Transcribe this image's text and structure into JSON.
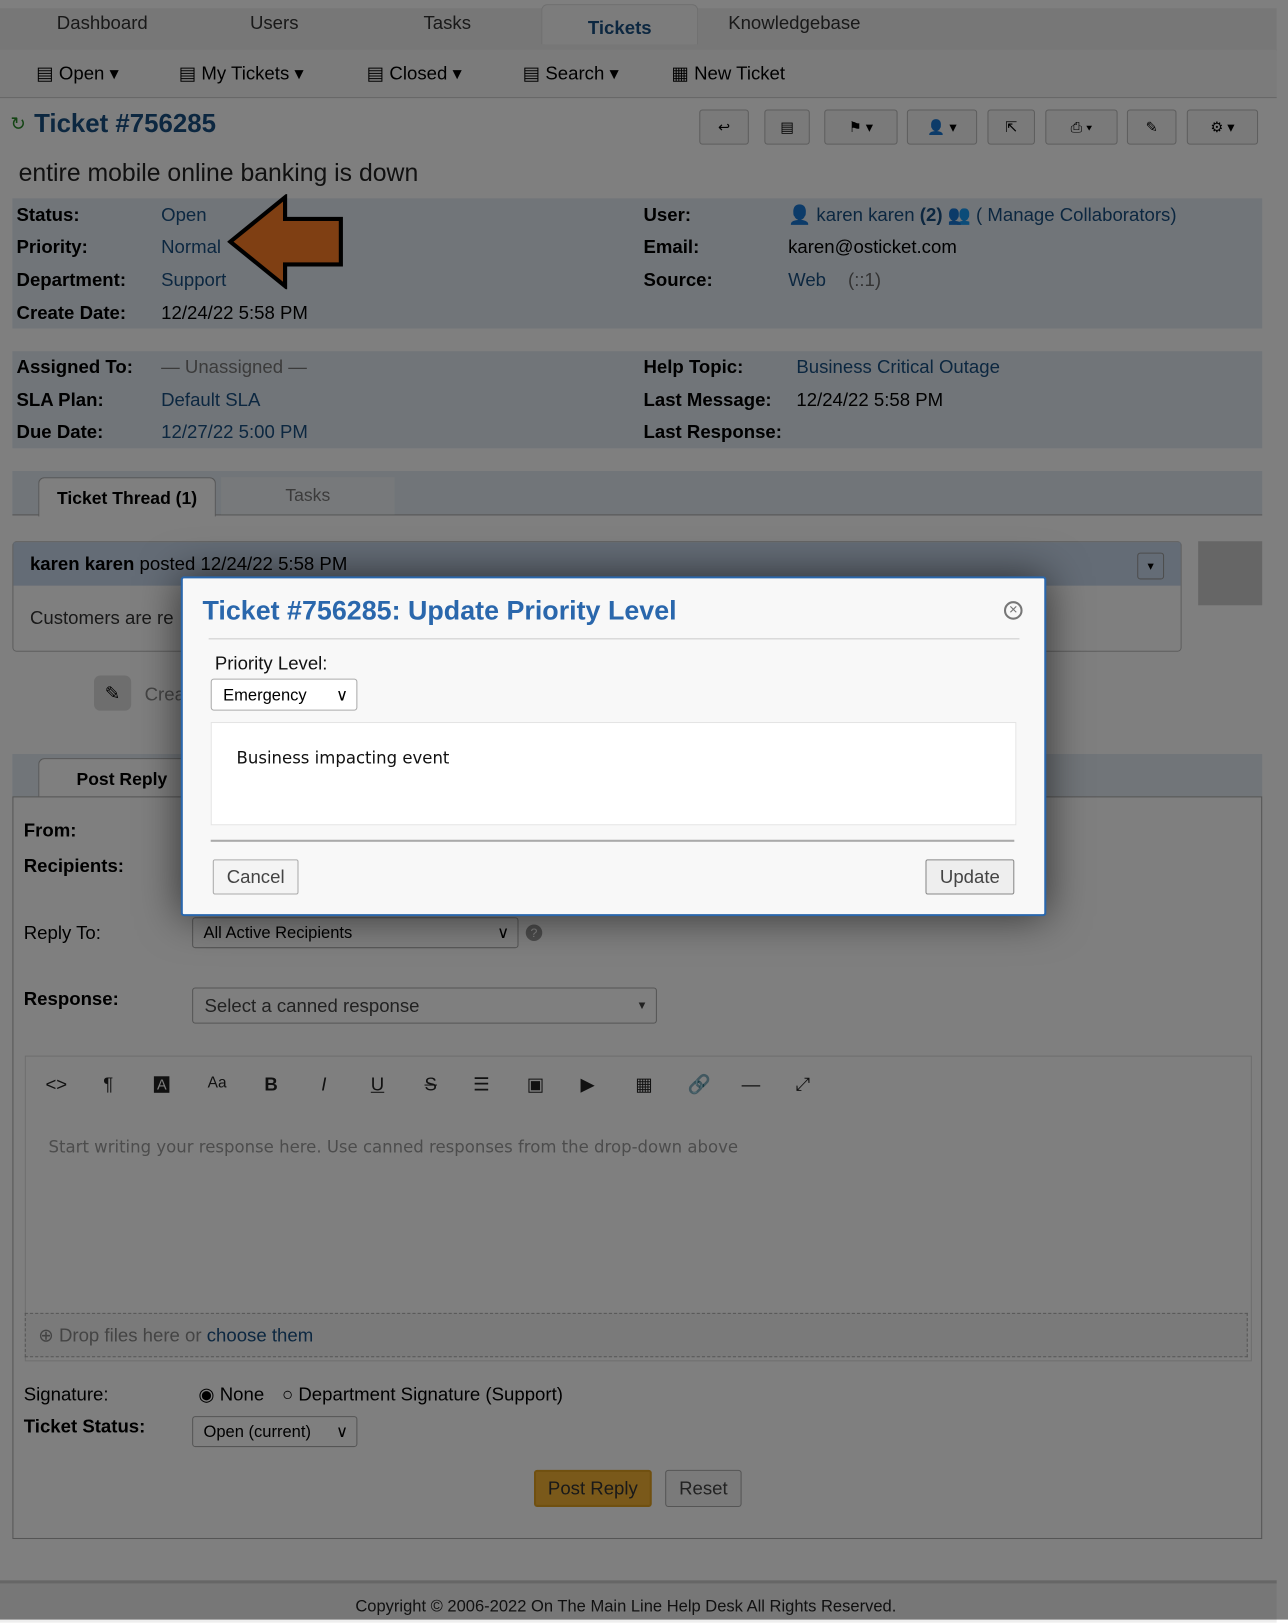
{
  "nav": {
    "tabs": [
      "Dashboard",
      "Users",
      "Tasks",
      "Tickets",
      "Knowledgebase"
    ],
    "active": "Tickets"
  },
  "subnav": [
    "Open",
    "My Tickets",
    "Closed",
    "Search",
    "New Ticket"
  ],
  "ticket": {
    "number": "Ticket #756285",
    "subject": "entire mobile online banking is down"
  },
  "info": {
    "status_label": "Status:",
    "status": "Open",
    "priority_label": "Priority:",
    "priority": "Normal",
    "department_label": "Department:",
    "department": "Support",
    "create_label": "Create Date:",
    "create": "12/24/22 5:58 PM",
    "user_label": "User:",
    "user": "karen karen",
    "user_count": "(2)",
    "collab": "( Manage Collaborators)",
    "email_label": "Email:",
    "email": "karen@osticket.com",
    "source_label": "Source:",
    "source": "Web",
    "source_ip": "(::1)",
    "assigned_label": "Assigned To:",
    "assigned": "— Unassigned —",
    "sla_label": "SLA Plan:",
    "sla": "Default SLA",
    "due_label": "Due Date:",
    "due": "12/27/22 5:00 PM",
    "topic_label": "Help Topic:",
    "topic": "Business Critical Outage",
    "lastmsg_label": "Last Message:",
    "lastmsg": "12/24/22 5:58 PM",
    "lastresp_label": "Last Response:"
  },
  "thread": {
    "tabs": [
      "Ticket Thread (1)",
      "Tasks"
    ],
    "author": "karen karen",
    "posted": "posted 12/24/22 5:58 PM",
    "body": "Customers are re",
    "event": "Crea"
  },
  "reply": {
    "tab": "Post Reply",
    "from": "From:",
    "recipients": "Recipients:",
    "reply_to_label": "Reply To:",
    "reply_to": "All Active Recipients",
    "response_label": "Response:",
    "response_placeholder": "Select a canned response",
    "editor_placeholder": "Start writing your response here. Use canned responses from the drop-down above",
    "drop": "Drop files here or ",
    "choose": "choose them",
    "signature_label": "Signature:",
    "sig_none": "None",
    "sig_dept": "Department Signature (Support)",
    "status_label": "Ticket Status:",
    "status": "Open (current)",
    "post": "Post Reply",
    "reset": "Reset"
  },
  "footer": "Copyright © 2006-2022 On The Main Line Help Desk All Rights Reserved.",
  "dialog": {
    "title": "Ticket #756285: Update Priority Level",
    "field_label": "Priority Level:",
    "selected": "Emergency",
    "description": "Business impacting event",
    "cancel": "Cancel",
    "update": "Update"
  },
  "colors": {
    "accent": "#184e81",
    "dialog_title": "#2a67ac",
    "arrow": "#ff7f27",
    "post_button": "#f5b335"
  }
}
